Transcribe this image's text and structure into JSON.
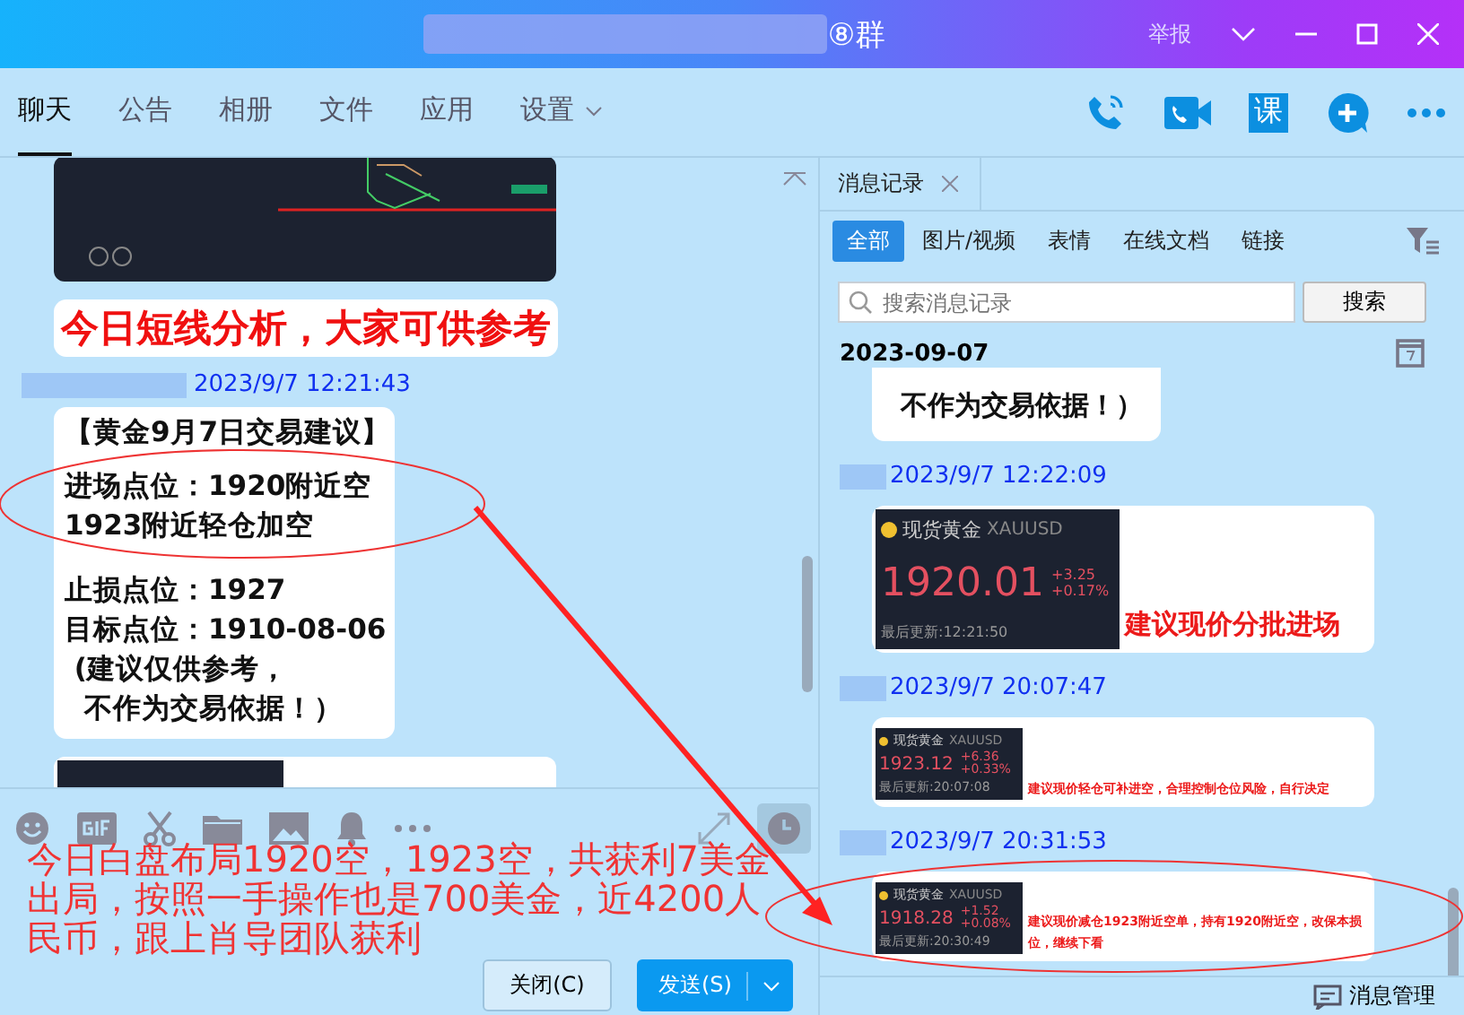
{
  "window": {
    "title": "⑧群",
    "report": "举报"
  },
  "tabs": [
    {
      "label": "聊天",
      "selected": true,
      "dropdown": false
    },
    {
      "label": "公告",
      "selected": false,
      "dropdown": false
    },
    {
      "label": "相册",
      "selected": false,
      "dropdown": false
    },
    {
      "label": "文件",
      "selected": false,
      "dropdown": false
    },
    {
      "label": "应用",
      "selected": false,
      "dropdown": false
    },
    {
      "label": "设置",
      "selected": false,
      "dropdown": true
    }
  ],
  "course_button": "课",
  "chat": {
    "messages": [
      {
        "kind": "chart_image"
      },
      {
        "kind": "headline",
        "text": "今日短线分析，大家可供参考"
      },
      {
        "kind": "timestamp",
        "time": "2023/9/7 12:21:43"
      },
      {
        "kind": "text",
        "paragraphs": [
          [
            "【黄金9月7日交易建议】",
            "进场点位：1920附近空",
            "1923附近轻仓加空"
          ],
          [
            "止损点位：1927",
            "目标点位：1910-08-06",
            " (建议仅供参考，",
            "  不作为交易依据！）"
          ]
        ]
      },
      {
        "kind": "partial_image"
      }
    ]
  },
  "annotation": "今日白盘布局1920空，1923空，共获利7美金出局，按照一手操作也是700美金，近4200人民币，跟上肖导团队获利",
  "buttons": {
    "close": "关闭(C)",
    "send": "发送(S)"
  },
  "history": {
    "title": "消息记录",
    "filters": [
      {
        "label": "全部",
        "selected": true
      },
      {
        "label": "图片/视频",
        "selected": false
      },
      {
        "label": "表情",
        "selected": false
      },
      {
        "label": "在线文档",
        "selected": false
      },
      {
        "label": "链接",
        "selected": false
      }
    ],
    "search": {
      "placeholder": "搜索消息记录",
      "button": "搜索"
    },
    "date": "2023-09-07",
    "entries": [
      {
        "kind": "text",
        "lines": [
          "不作为交易依据！）"
        ]
      },
      {
        "kind": "timestamp",
        "time": "2023/9/7 12:22:09"
      },
      {
        "kind": "quote_large",
        "name": "现货黄金",
        "symbol": "XAUUSD",
        "price": "1920.01",
        "change": "+3.25",
        "pct": "+0.17%",
        "updated": "最后更新:12:21:50",
        "note": "建议现价分批进场"
      },
      {
        "kind": "timestamp",
        "time": "2023/9/7 20:07:47"
      },
      {
        "kind": "quote_small",
        "name": "现货黄金",
        "symbol": "XAUUSD",
        "price": "1923.12",
        "change": "+6.36",
        "pct": "+0.33%",
        "updated": "最后更新:20:07:08",
        "note": "建议现价轻仓可补进空，合理控制仓位风险，自行决定"
      },
      {
        "kind": "timestamp",
        "time": "2023/9/7 20:31:53"
      },
      {
        "kind": "quote_small",
        "name": "现货黄金",
        "symbol": "XAUUSD",
        "price": "1918.28",
        "change": "+1.52",
        "pct": "+0.08%",
        "updated": "最后更新:20:30:49",
        "note": "建议现价减仓1923附近空单，持有1920附近空，改保本损位，继续下看"
      }
    ],
    "manage": "消息管理"
  }
}
